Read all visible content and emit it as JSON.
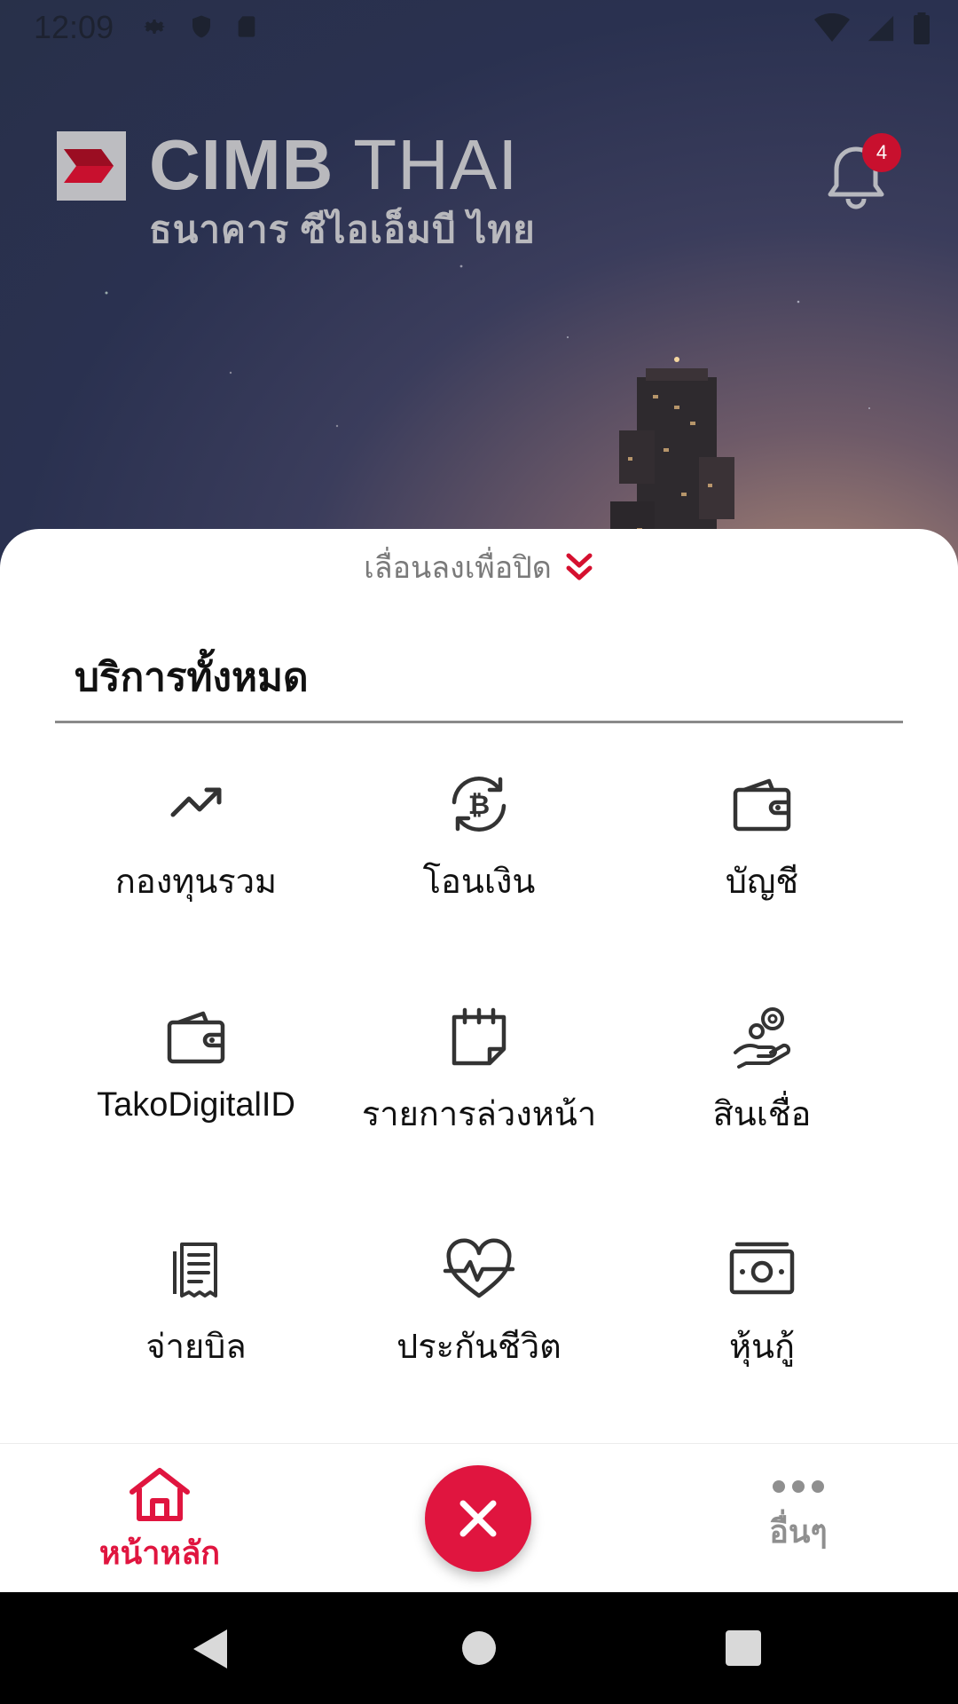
{
  "status_bar": {
    "time": "12:09"
  },
  "header": {
    "brand_name_bold": "CIMB",
    "brand_name_light": " THAI",
    "brand_subtitle": "ธนาคาร ซีไอเอ็มบี ไทย",
    "notification_count": "4"
  },
  "sheet": {
    "dismiss_label": "เลื่อนลงเพื่อปิด",
    "title": "บริการทั้งหมด",
    "services": [
      {
        "label": "กองทุนรวม",
        "icon": "trending-up-icon"
      },
      {
        "label": "โอนเงิน",
        "icon": "bitcoin-exchange-icon"
      },
      {
        "label": "บัญชี",
        "icon": "wallet-icon"
      },
      {
        "label": "TakoDigitalID",
        "icon": "wallet-icon"
      },
      {
        "label": "รายการล่วงหน้า",
        "icon": "calendar-note-icon"
      },
      {
        "label": "สินเชื่อ",
        "icon": "hand-coin-icon"
      },
      {
        "label": "จ่ายบิล",
        "icon": "receipt-icon"
      },
      {
        "label": "ประกันชีวิต",
        "icon": "heart-pulse-icon"
      },
      {
        "label": "หุ้นกู้",
        "icon": "banknote-icon"
      }
    ]
  },
  "bottom_nav": {
    "home_label": "หน้าหลัก",
    "more_label": "อื่นๆ",
    "active_color": "#e0153f"
  }
}
